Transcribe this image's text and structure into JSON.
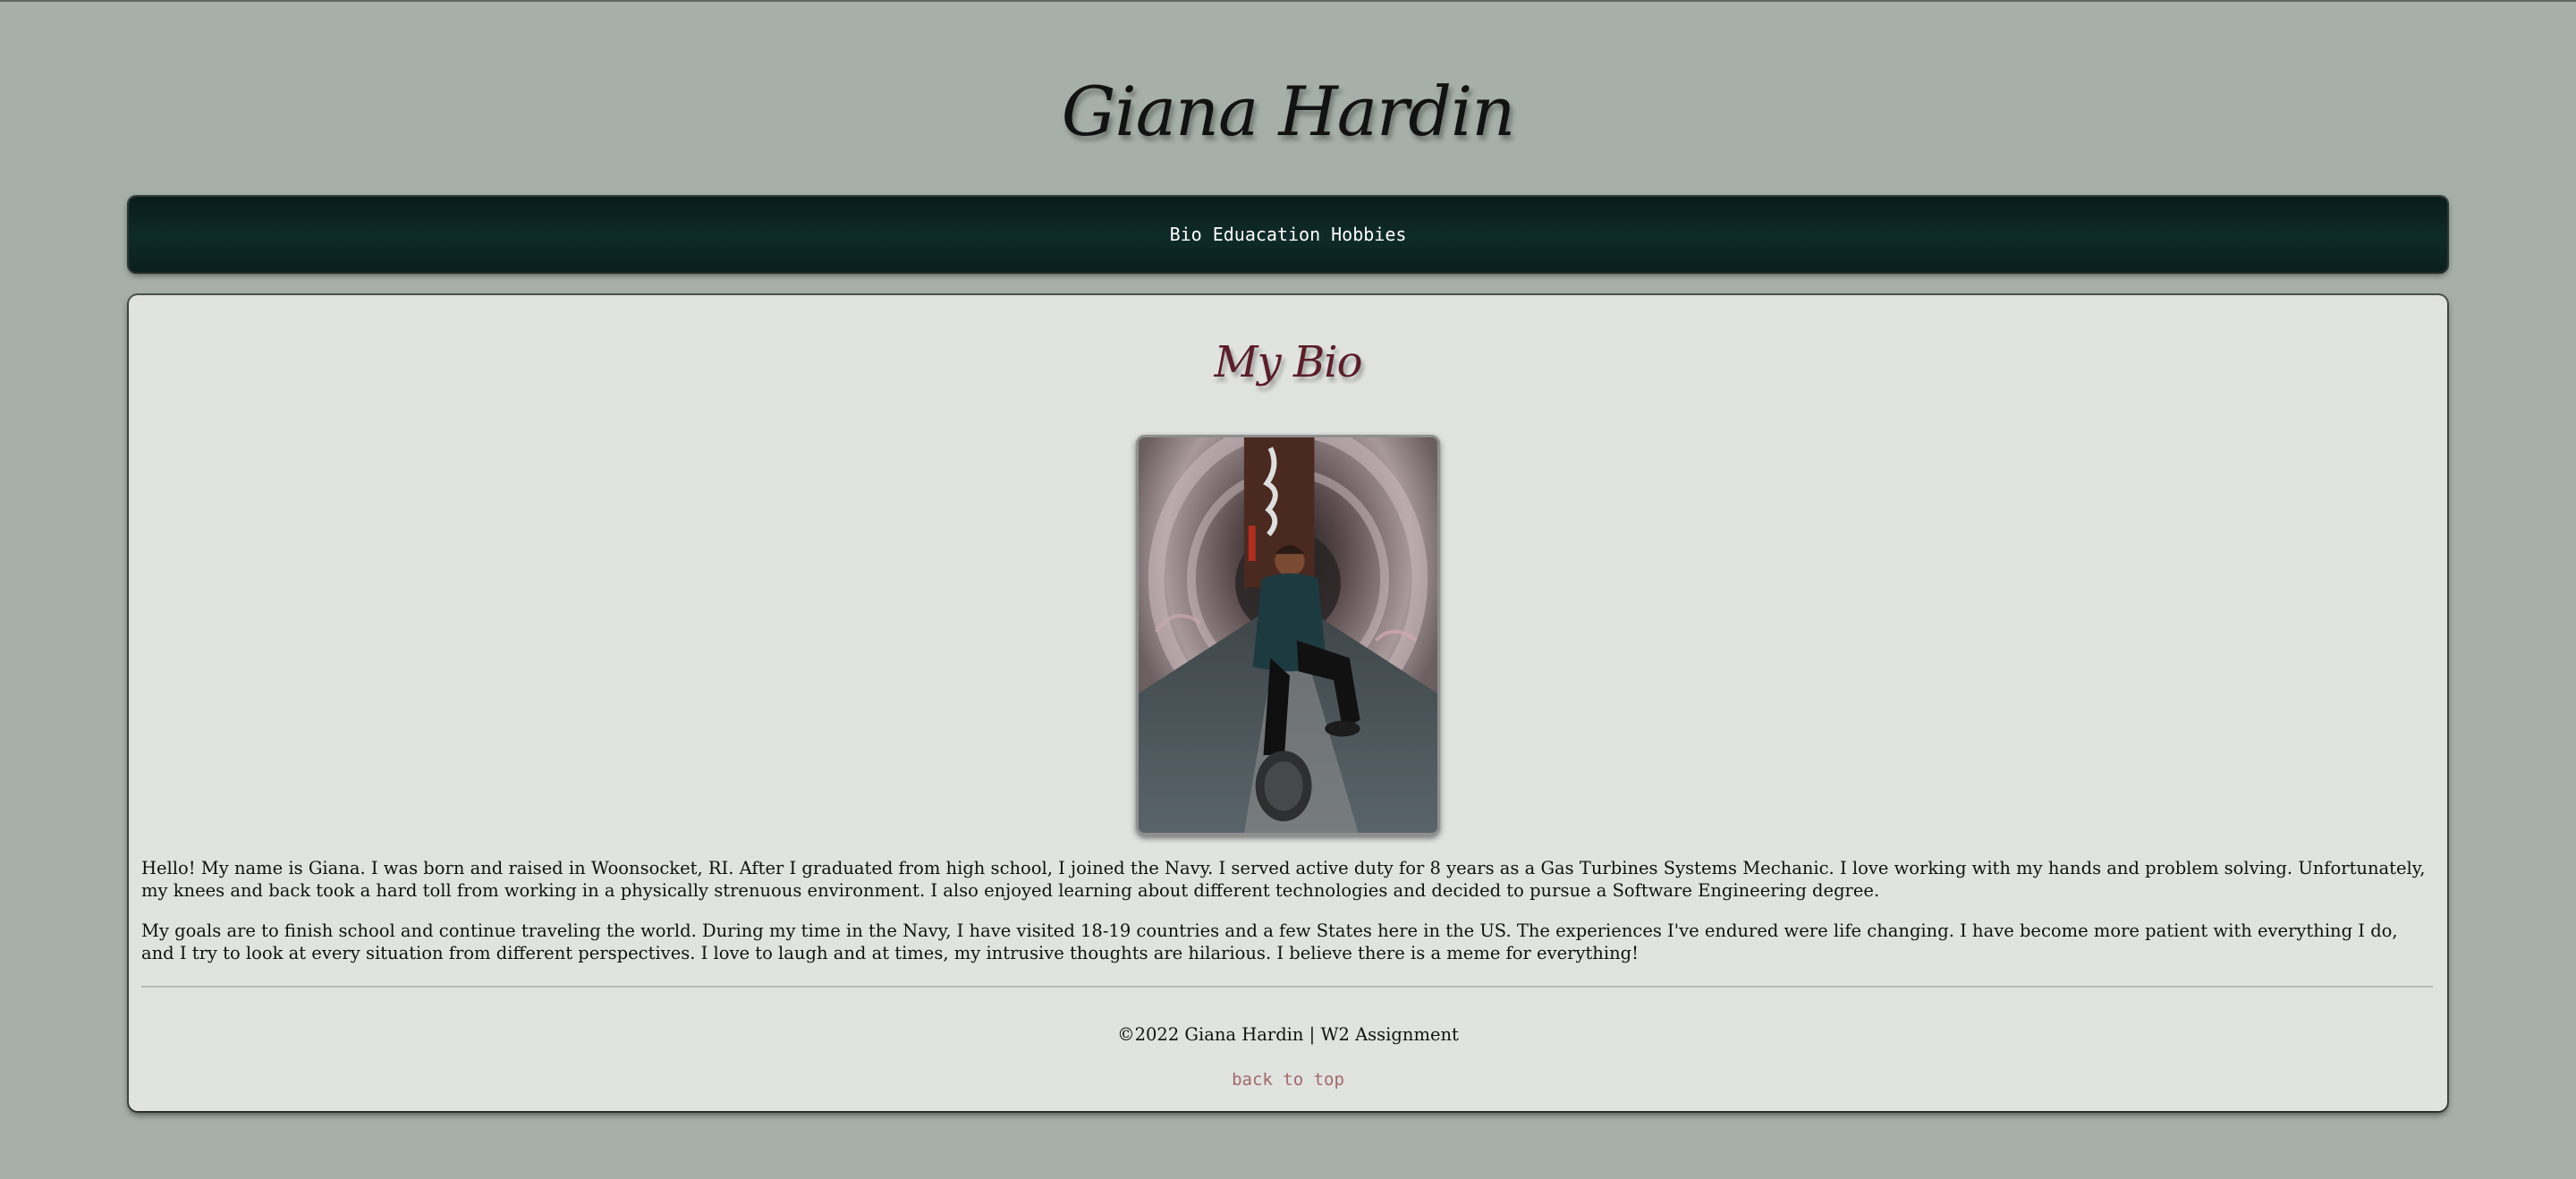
{
  "header": {
    "title": "Giana Hardin"
  },
  "nav": {
    "items": [
      {
        "label": "Bio"
      },
      {
        "label": "Eduacation"
      },
      {
        "label": "Hobbies"
      }
    ]
  },
  "main": {
    "section_title": "My Bio",
    "photo": {
      "alt": "Photo of Giana Hardin sitting in a graffiti tunnel"
    },
    "paragraphs": [
      "Hello! My name is Giana. I was born and raised in Woonsocket, RI. After I graduated from high school, I joined the Navy. I served active duty for 8 years as a Gas Turbines Systems Mechanic. I love working with my hands and problem solving. Unfortunately, my knees and back took a hard toll from working in a physically strenuous environment. I also enjoyed learning about different technologies and decided to pursue a Software Engineering degree.",
      "My goals are to finish school and continue traveling the world. During my time in the Navy, I have visited 18-19 countries and a few States here in the US. The experiences I've endured were life changing. I have become more patient with everything I do, and I try to look at every situation from different perspectives. I love to laugh and at times, my intrusive thoughts are hilarious. I believe there is a meme for everything!"
    ]
  },
  "footer": {
    "copyright": "©2022 Giana Hardin | W2 Assignment",
    "back_to_top": "back to top"
  },
  "colors": {
    "page_background": "#a6b0a8",
    "nav_background": "#0e2b28",
    "card_background": "#e1e3e0",
    "section_title": "#5a1e2a",
    "back_to_top_link": "#a16a6a"
  }
}
